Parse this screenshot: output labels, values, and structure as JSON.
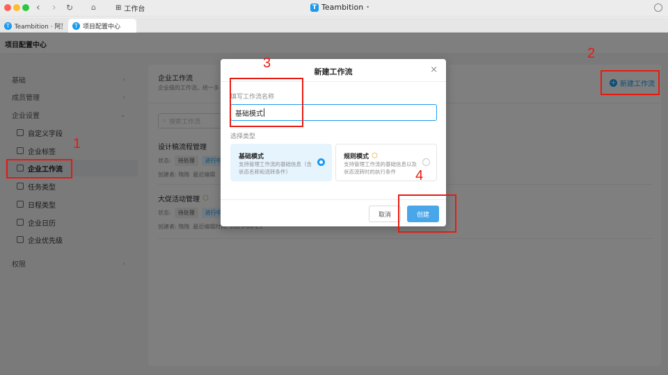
{
  "titlebar": {
    "workspace_label": "工作台",
    "app_title": "Teambition",
    "app_title_suffix": "•",
    "logo_letter": "T"
  },
  "tabs": [
    {
      "label": "Teambition · 阿里巴巴"
    },
    {
      "label": "项目配置中心"
    }
  ],
  "page": {
    "title": "项目配置中心"
  },
  "sidebar": {
    "items": [
      {
        "label": "基础",
        "arrow": "›"
      },
      {
        "label": "成员管理",
        "arrow": "›"
      },
      {
        "label": "企业设置",
        "arrow": "⌄"
      }
    ],
    "sub_items": [
      {
        "label": "自定义字段"
      },
      {
        "label": "企业标签"
      },
      {
        "label": "企业工作流"
      },
      {
        "label": "任务类型"
      },
      {
        "label": "日程类型"
      },
      {
        "label": "企业日历"
      },
      {
        "label": "企业优先级"
      }
    ],
    "bottom_item": {
      "label": "权限",
      "arrow": "›"
    }
  },
  "content": {
    "title": "企业工作流",
    "desc": "企业级的工作流，统一多",
    "new_button": "新建工作流",
    "search_placeholder": "搜索工作流",
    "rows": [
      {
        "name": "设计稿流程管理",
        "status_label": "状态:",
        "tag1": "待处理",
        "tag2": "进行中",
        "creator": "创建者: 隋隋",
        "edit": "最近编辑"
      },
      {
        "name": "大促活动管理",
        "status_label": "状态:",
        "tag1": "待处理",
        "tag2": "进行中",
        "creator": "创建者: 隋隋",
        "edit": "最近编辑时间: 2023-06-25"
      }
    ]
  },
  "modal": {
    "title": "新建工作流",
    "close": "×",
    "name_label": "填写工作流名称",
    "name_value": "基础模式",
    "type_label": "选择类型",
    "types": [
      {
        "name": "基础模式",
        "desc": "支持管理工作流的基础信息（含状态名称和流转条件）",
        "selected": true
      },
      {
        "name": "规则模式",
        "desc": "支持管理工作流的基础信息以及状态流转时的执行条件",
        "selected": false
      }
    ],
    "cancel": "取消",
    "create": "创建"
  },
  "annotations": [
    "1",
    "2",
    "3",
    "4"
  ],
  "colors": {
    "accent": "#1b9aee",
    "annotation": "#e8190f",
    "create_button": "#49a6e9"
  }
}
